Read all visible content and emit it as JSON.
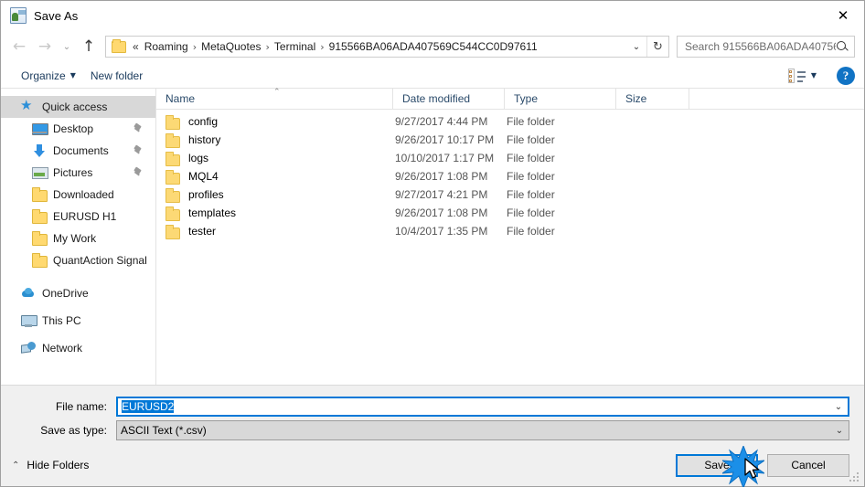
{
  "window": {
    "title": "Save As",
    "icon": "app-icon",
    "close_label": "✕"
  },
  "nav": {
    "back": "←",
    "forward": "→",
    "history_caret": "⌄",
    "up": "↑",
    "recent_caret": "⌄",
    "refresh": "↻",
    "breadcrumb_prefix": "«",
    "breadcrumbs": [
      {
        "label": "Roaming"
      },
      {
        "label": "MetaQuotes"
      },
      {
        "label": "Terminal"
      },
      {
        "label": "915566BA06ADA407569C544CC0D97611"
      }
    ],
    "separator": "›"
  },
  "search": {
    "placeholder": "Search 915566BA06ADA40756...",
    "icon": "search-icon"
  },
  "commandbar": {
    "organize": "Organize",
    "organize_caret": "▼",
    "new_folder": "New folder",
    "view_caret": "▼",
    "help": "?"
  },
  "sidebar": {
    "items": [
      {
        "label": "Quick access",
        "icon": "star-icon",
        "selected": true,
        "level": 0,
        "pinned": false
      },
      {
        "label": "Desktop",
        "icon": "desktop-icon",
        "selected": false,
        "level": 1,
        "pinned": true
      },
      {
        "label": "Documents",
        "icon": "documents-icon",
        "selected": false,
        "level": 1,
        "pinned": true
      },
      {
        "label": "Pictures",
        "icon": "pictures-icon",
        "selected": false,
        "level": 1,
        "pinned": true
      },
      {
        "label": "Downloaded",
        "icon": "folder-icon",
        "selected": false,
        "level": 1,
        "pinned": false
      },
      {
        "label": "EURUSD H1",
        "icon": "folder-icon",
        "selected": false,
        "level": 1,
        "pinned": false
      },
      {
        "label": "My Work",
        "icon": "folder-icon",
        "selected": false,
        "level": 1,
        "pinned": false
      },
      {
        "label": "QuantAction Signal",
        "icon": "folder-icon",
        "selected": false,
        "level": 1,
        "pinned": false
      },
      {
        "label": "OneDrive",
        "icon": "onedrive-icon",
        "selected": false,
        "level": 0,
        "pinned": false
      },
      {
        "label": "This PC",
        "icon": "pc-icon",
        "selected": false,
        "level": 0,
        "pinned": false
      },
      {
        "label": "Network",
        "icon": "network-icon",
        "selected": false,
        "level": 0,
        "pinned": false
      }
    ]
  },
  "filelist": {
    "columns": [
      "Name",
      "Date modified",
      "Type",
      "Size"
    ],
    "sort_indicator": "⌃",
    "rows": [
      {
        "name": "config",
        "date": "9/27/2017 4:44 PM",
        "type": "File folder",
        "size": ""
      },
      {
        "name": "history",
        "date": "9/26/2017 10:17 PM",
        "type": "File folder",
        "size": ""
      },
      {
        "name": "logs",
        "date": "10/10/2017 1:17 PM",
        "type": "File folder",
        "size": ""
      },
      {
        "name": "MQL4",
        "date": "9/26/2017 1:08 PM",
        "type": "File folder",
        "size": ""
      },
      {
        "name": "profiles",
        "date": "9/27/2017 4:21 PM",
        "type": "File folder",
        "size": ""
      },
      {
        "name": "templates",
        "date": "9/26/2017 1:08 PM",
        "type": "File folder",
        "size": ""
      },
      {
        "name": "tester",
        "date": "10/4/2017 1:35 PM",
        "type": "File folder",
        "size": ""
      }
    ]
  },
  "form": {
    "filename_label": "File name:",
    "filename_value": "EURUSD2",
    "filetype_label": "Save as type:",
    "filetype_value": "ASCII Text (*.csv)",
    "dropdown_caret": "⌄"
  },
  "footer": {
    "hide_folders": "Hide Folders",
    "hide_caret": "⌃",
    "save": "Save",
    "cancel": "Cancel"
  },
  "colors": {
    "accent": "#0078d7",
    "folder": "#fcd975",
    "header_text": "#2a4a6a",
    "chrome": "#f0f0f0",
    "selection": "#d8d8d8"
  }
}
